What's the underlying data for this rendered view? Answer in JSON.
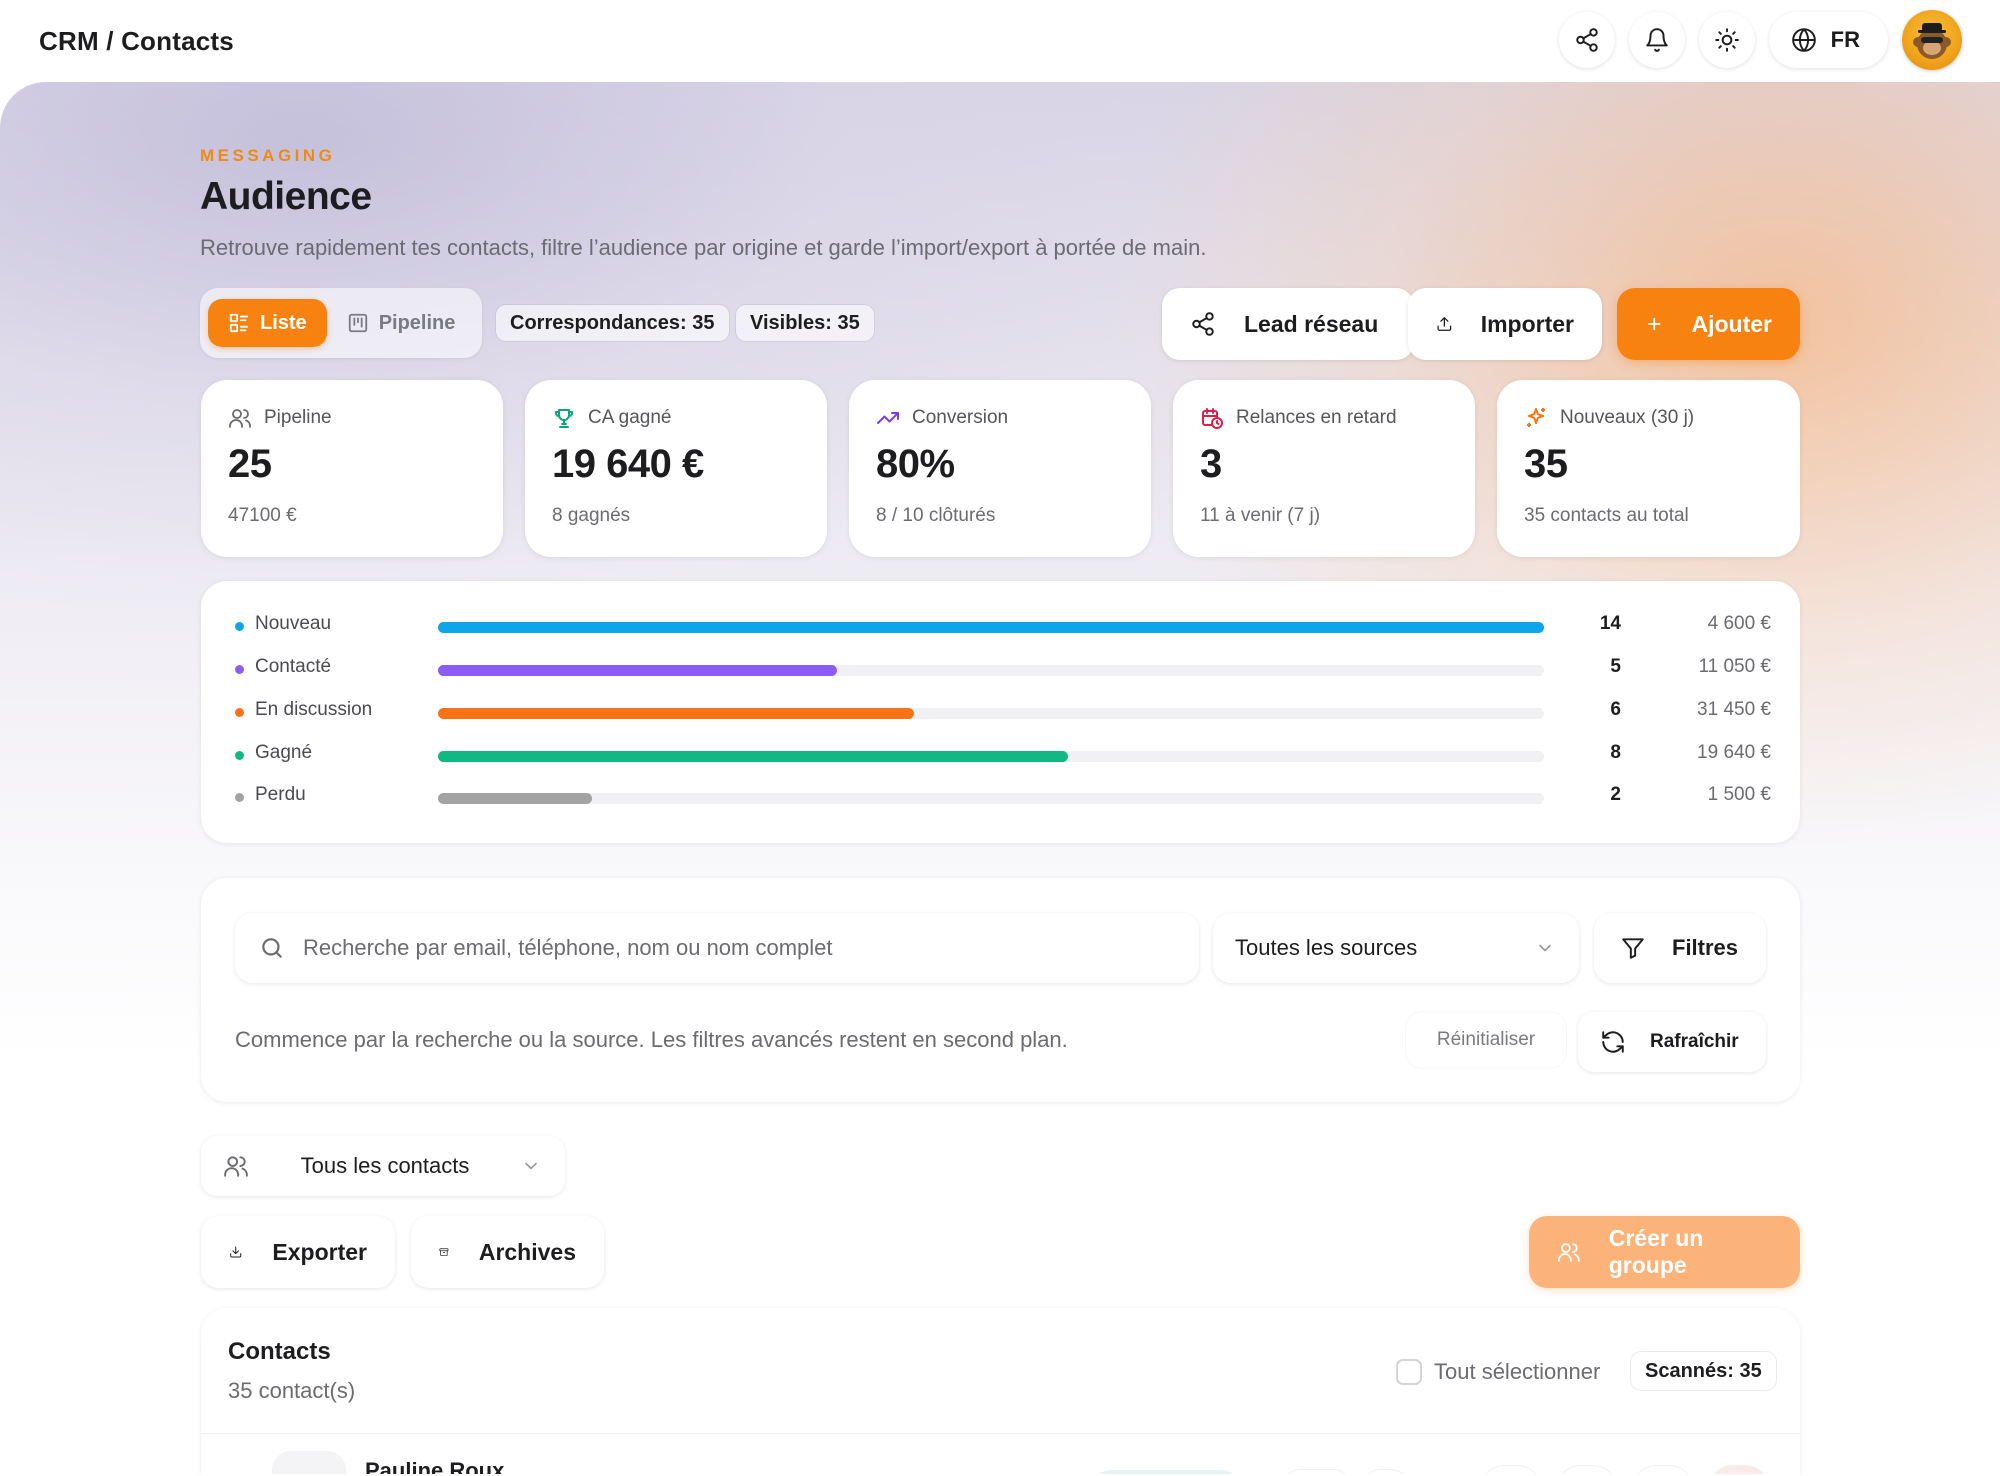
{
  "header": {
    "breadcrumb": "CRM / Contacts",
    "lang": "FR"
  },
  "page": {
    "eyebrow": "MESSAGING",
    "title": "Audience",
    "subtitle": "Retrouve rapidement tes contacts, filtre l’audience par origine et garde l’import/export à portée de main."
  },
  "toolbar": {
    "view_list": "Liste",
    "view_pipeline": "Pipeline",
    "matches": "Correspondances: 35",
    "visible": "Visibles: 35",
    "lead_network": "Lead réseau",
    "import": "Importer",
    "add": "Ajouter"
  },
  "stats": [
    {
      "label": "Pipeline",
      "value": "25",
      "sub": "47100 €",
      "icon": "users-icon"
    },
    {
      "label": "CA gagné",
      "value": "19 640 €",
      "sub": "8 gagnés",
      "icon": "trophy-icon"
    },
    {
      "label": "Conversion",
      "value": "80%",
      "sub": "8 / 10 clôturés",
      "icon": "trend-up-icon"
    },
    {
      "label": "Relances en retard",
      "value": "3",
      "sub": "11 à venir (7 j)",
      "icon": "calendar-clock-icon"
    },
    {
      "label": "Nouveaux (30 j)",
      "value": "35",
      "sub": "35 contacts au total",
      "icon": "sparkles-icon"
    }
  ],
  "stages": [
    {
      "label": "Nouveau",
      "count": "14",
      "amount": "4 600 €",
      "color": "#0ea5e9"
    },
    {
      "label": "Contacté",
      "count": "5",
      "amount": "11 050 €",
      "color": "#8b5cf6"
    },
    {
      "label": "En discussion",
      "count": "6",
      "amount": "31 450 €",
      "color": "#f97316"
    },
    {
      "label": "Gagné",
      "count": "8",
      "amount": "19 640 €",
      "color": "#10b981"
    },
    {
      "label": "Perdu",
      "count": "2",
      "amount": "1 500 €",
      "color": "#a3a3a3"
    }
  ],
  "filters": {
    "search_placeholder": "Recherche par email, téléphone, nom ou nom complet",
    "source_value": "Toutes les sources",
    "filters_label": "Filtres",
    "hint": "Commence par la recherche ou la source. Les filtres avancés restent en second plan.",
    "reset": "Réinitialiser",
    "refresh": "Rafraîchir"
  },
  "segment": {
    "value": "Tous les contacts"
  },
  "actions": {
    "export": "Exporter",
    "archives": "Archives",
    "create_group": "Créer un groupe"
  },
  "contacts": {
    "title": "Contacts",
    "count": "35 contact(s)",
    "select_all": "Tout sélectionner",
    "scanned": "Scannés: 35",
    "first_row_name": "Pauline Roux"
  },
  "colors": {
    "accent": "#f7820f"
  }
}
